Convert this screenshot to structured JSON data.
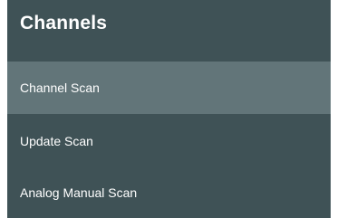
{
  "header": {
    "title": "Channels"
  },
  "menu": {
    "selected_index": 0,
    "items": [
      {
        "label": "Channel Scan"
      },
      {
        "label": "Update Scan"
      },
      {
        "label": "Analog Manual Scan"
      }
    ]
  },
  "colors": {
    "panel_background": "#3f5256",
    "selected_background": "#627579",
    "text": "#ffffff"
  }
}
